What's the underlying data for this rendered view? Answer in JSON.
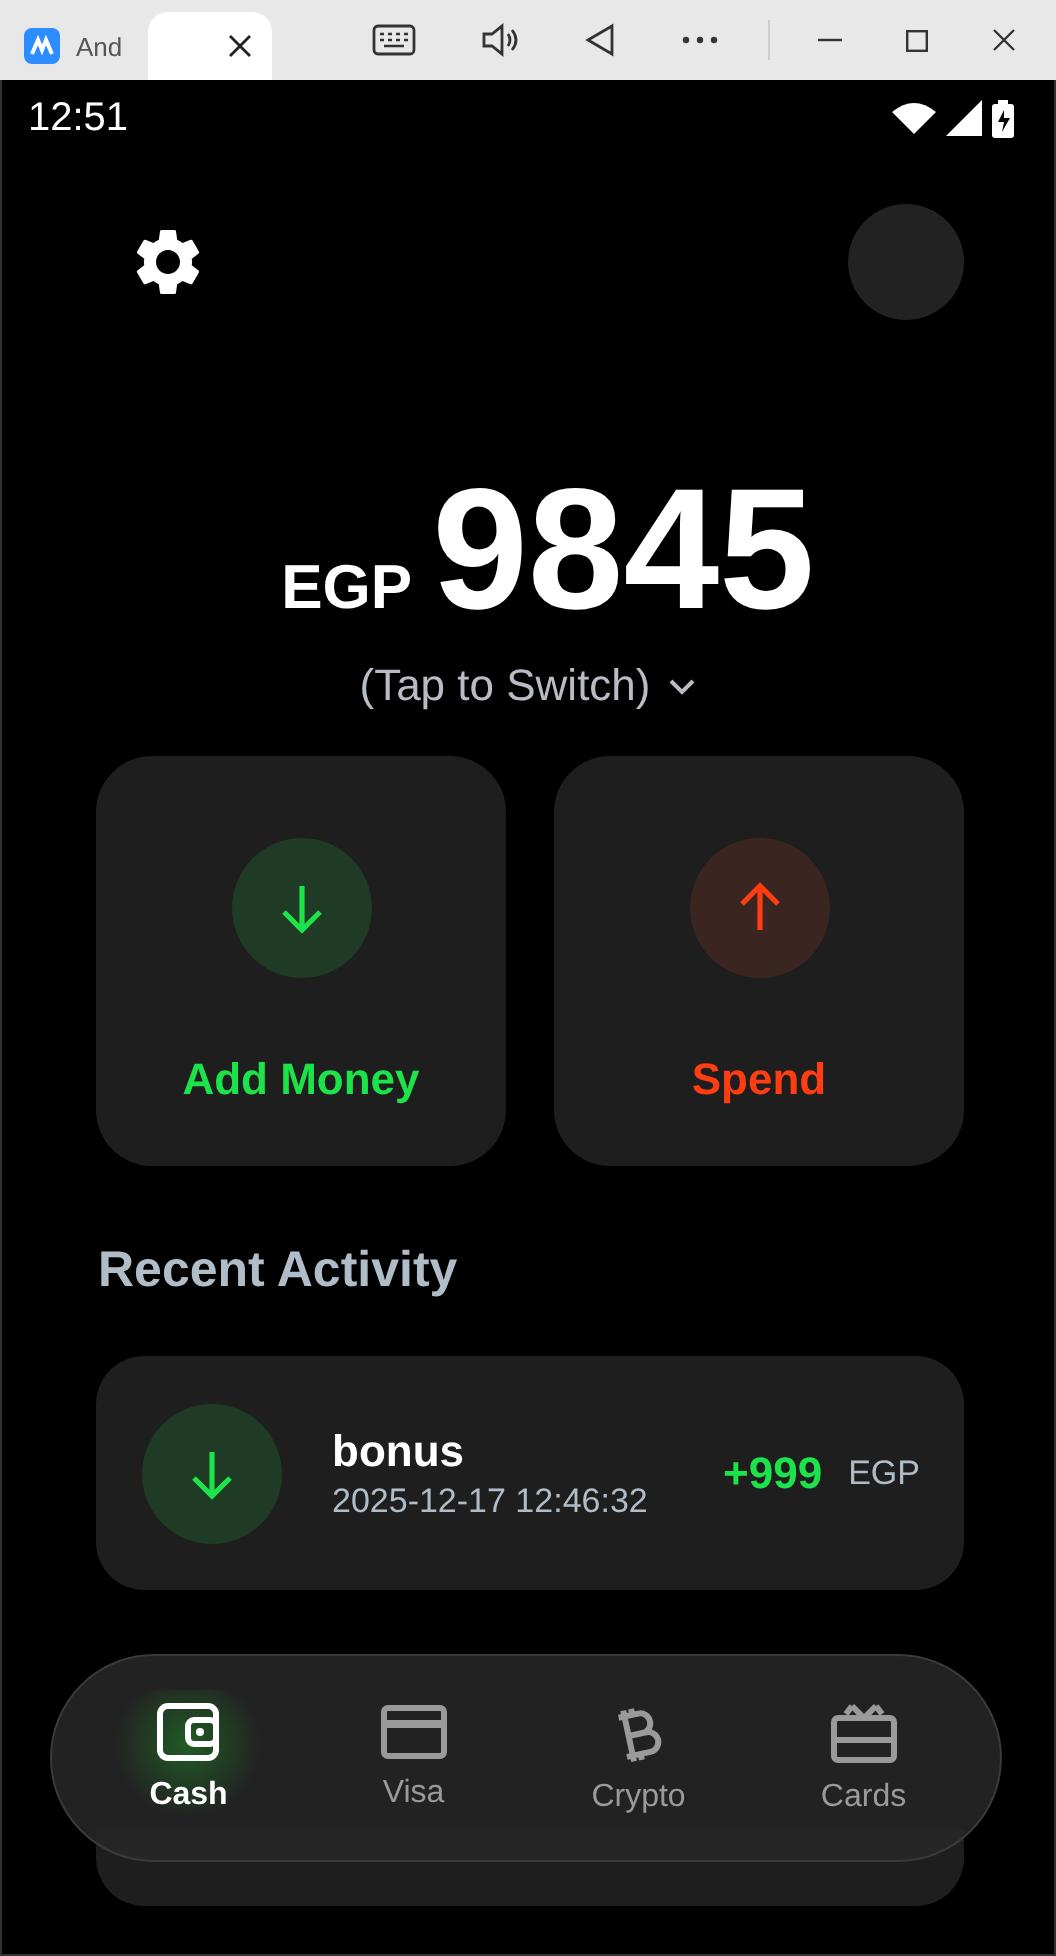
{
  "window": {
    "tabs": [
      {
        "label": "And",
        "selected": false
      },
      {
        "selected": true
      }
    ]
  },
  "status_bar": {
    "time": "12:51"
  },
  "balance": {
    "currency": "EGP",
    "amount": "9845",
    "switch_hint": "(Tap to Switch)"
  },
  "actions": [
    {
      "kind": "add",
      "label": "Add Money"
    },
    {
      "kind": "spend",
      "label": "Spend"
    }
  ],
  "recent_activity": {
    "title": "Recent Activity",
    "items": [
      {
        "kind": "credit",
        "name": "bonus",
        "time": "2025-12-17 12:46:32",
        "amount": "+999",
        "currency": "EGP"
      }
    ]
  },
  "nav": [
    {
      "kind": "wallet",
      "label": "Cash",
      "selected": true
    },
    {
      "kind": "card",
      "label": "Visa",
      "selected": false
    },
    {
      "kind": "bitcoin",
      "label": "Crypto",
      "selected": false
    },
    {
      "kind": "gift",
      "label": "Cards",
      "selected": false
    }
  ]
}
